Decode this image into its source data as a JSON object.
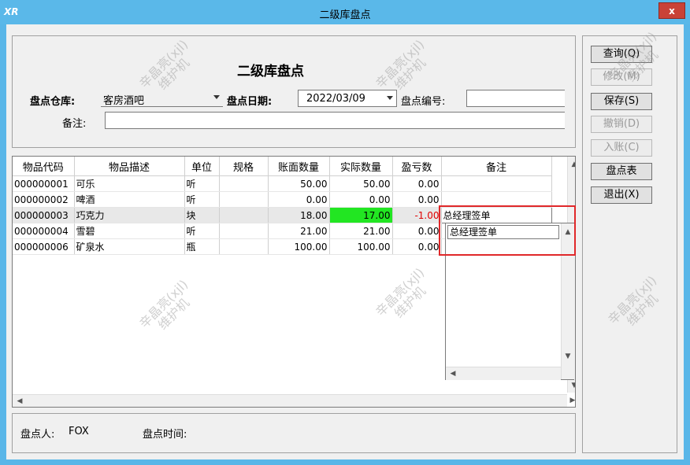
{
  "window": {
    "icon_text": "XR",
    "title": "二级库盘点",
    "close_label": "x"
  },
  "header": {
    "title": "二级库盘点",
    "warehouse_label": "盘点仓库:",
    "warehouse_value": "客房酒吧",
    "date_label": "盘点日期:",
    "date_value": "2022/03/09",
    "number_label": "盘点编号:",
    "number_value": "",
    "remark_label": "备注:",
    "remark_value": ""
  },
  "buttons": {
    "query": "查询(Q)",
    "modify": "修改(M)",
    "save": "保存(S)",
    "cancel": "撤销(D)",
    "post": "入账(C)",
    "sheet": "盘点表",
    "exit": "退出(X)"
  },
  "table": {
    "columns": [
      "物品代码",
      "物品描述",
      "单位",
      "规格",
      "账面数量",
      "实际数量",
      "盈亏数",
      "备注"
    ],
    "rows": [
      {
        "code": "000000001",
        "desc": "可乐",
        "unit": "听",
        "spec": "",
        "book": "50.00",
        "actual": "50.00",
        "diff": "0.00",
        "note": ""
      },
      {
        "code": "000000002",
        "desc": "啤酒",
        "unit": "听",
        "spec": "",
        "book": "0.00",
        "actual": "0.00",
        "diff": "0.00",
        "note": ""
      },
      {
        "code": "000000003",
        "desc": "巧克力",
        "unit": "块",
        "spec": "",
        "book": "18.00",
        "actual": "17.00",
        "diff": "-1.00",
        "note": "总经理签单"
      },
      {
        "code": "000000004",
        "desc": "雪碧",
        "unit": "听",
        "spec": "",
        "book": "21.00",
        "actual": "21.00",
        "diff": "0.00",
        "note": ""
      },
      {
        "code": "000000006",
        "desc": "矿泉水",
        "unit": "瓶",
        "spec": "",
        "book": "100.00",
        "actual": "100.00",
        "diff": "0.00",
        "note": ""
      }
    ],
    "popup_text": "总经理签单"
  },
  "footer": {
    "counter_label": "盘点人:",
    "counter_value": "FOX",
    "time_label": "盘点时间:",
    "time_value": ""
  },
  "watermark": "辛晶亮(xjl)\n维护机",
  "colors": {
    "titlebar": "#5ab8e9",
    "close": "#c94237",
    "highlight_green": "#22e622",
    "negative_red": "#e00000",
    "annotation_box": "#e0282a"
  }
}
